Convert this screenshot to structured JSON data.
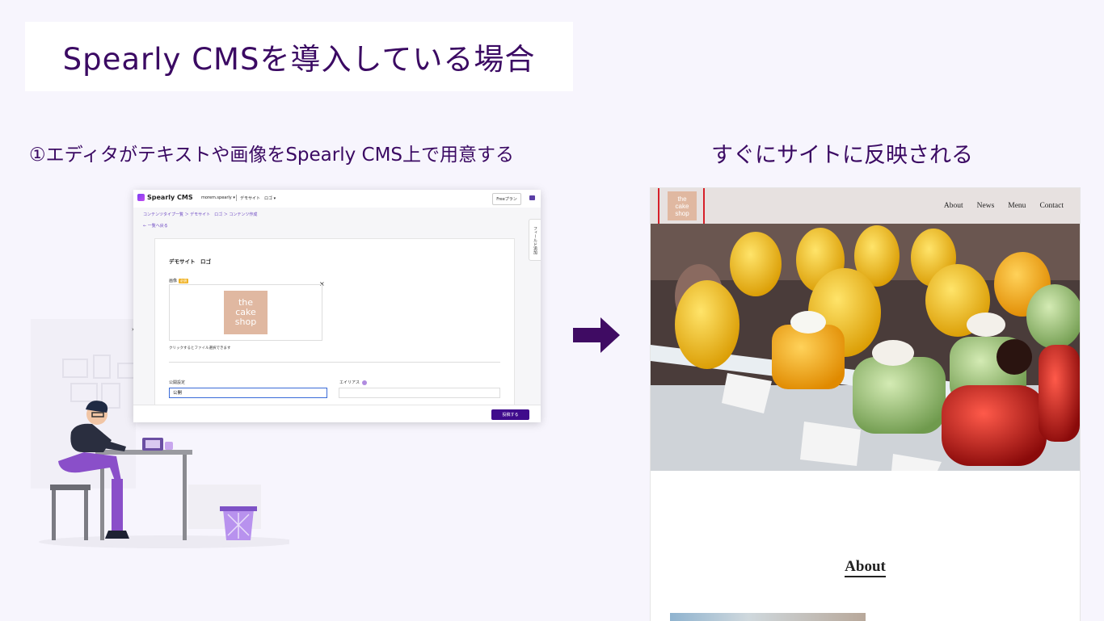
{
  "title": "Spearly CMSを導入している場合",
  "step_left": "①エディタがテキストや画像をSpearly CMS上で用意する",
  "step_right": "すぐにサイトに反映される",
  "cms": {
    "logo": "Spearly CMS",
    "workspace": "morem.spearly ▾",
    "project": "デモサイト　ロゴ ▾",
    "plan_button": "Freeプラン",
    "breadcrumb": "コンテンツタイプ一覧 ＞ デモサイト　ロゴ ＞ コンテンツ作成",
    "back_link": "← 一覧へ戻る",
    "side_tab": "フィールド追加",
    "heading": "デモサイト　ロゴ",
    "image_label": "画像",
    "required_badge": "必須",
    "remove": "×",
    "cake_lines": [
      "the",
      "cake",
      "shop"
    ],
    "hint": "クリックするとファイル選択できます",
    "publish_label": "公開設定",
    "publish_value": "公開",
    "alias_label": "エイリアス",
    "submit": "投稿する",
    "collapse": "›"
  },
  "site": {
    "logo_lines": [
      "the",
      "cake",
      "shop"
    ],
    "nav": [
      "About",
      "News",
      "Menu",
      "Contact"
    ],
    "about_heading": "About"
  },
  "colors": {
    "title": "#3b0a63",
    "accent": "#3f0b8c",
    "cake_logo": "#e0b8a1",
    "highlight_frame": "#d6202a"
  }
}
